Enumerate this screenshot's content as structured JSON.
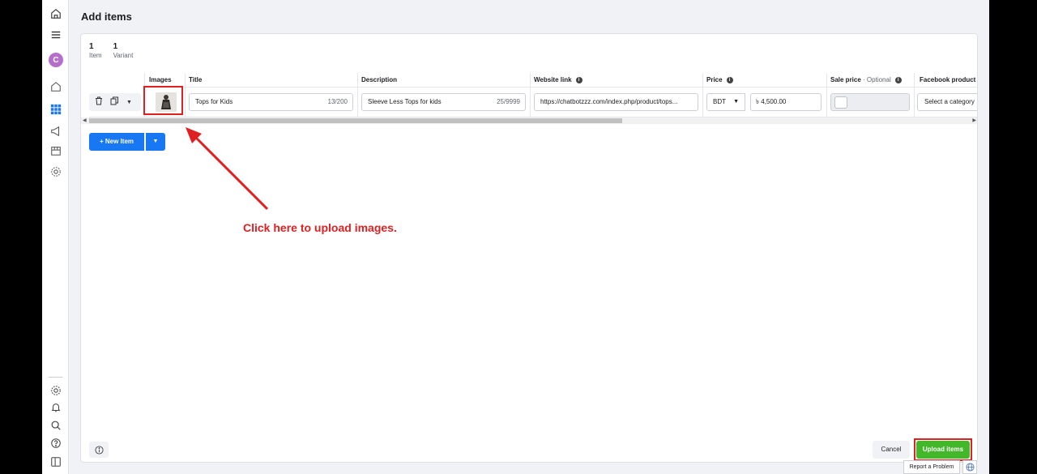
{
  "page": {
    "title": "Add items"
  },
  "counts": [
    {
      "num": "1",
      "label": "Item"
    },
    {
      "num": "1",
      "label": "Variant"
    }
  ],
  "nav": {
    "avatar_letter": "C",
    "icons": [
      "home-icon",
      "menu-icon",
      "home-outline-icon",
      "grid-icon",
      "megaphone-icon",
      "storefront-icon",
      "settings-icon",
      "gear-icon",
      "bell-icon",
      "search-icon",
      "help-icon",
      "sidebar-toggle-icon"
    ]
  },
  "table": {
    "headers": {
      "images": "Images",
      "title": "Title",
      "description": "Description",
      "website_link": "Website link",
      "price": "Price",
      "sale_price": "Sale price",
      "sale_price_optional": " · Optional",
      "facebook_category": "Facebook product c"
    },
    "row": {
      "title": {
        "value": "Tops for Kids",
        "count": "13/200"
      },
      "description": {
        "value": "Sleeve Less Tops for kids",
        "count": "25/9999"
      },
      "website_link": "https://chatbotzzz.com/index.php/product/tops...",
      "currency": "BDT",
      "price": "৳ 4,500.00",
      "category_placeholder": "Select a category"
    }
  },
  "buttons": {
    "new_item": "+  New Item",
    "cancel": "Cancel",
    "upload": "Upload items",
    "report": "Report a Problem"
  },
  "annotation": {
    "text": "Click here to upload images.",
    "color": "#e02020"
  },
  "colors": {
    "primary": "#1877f2",
    "upload_green": "#42b72a",
    "highlight_red": "#e02020"
  }
}
